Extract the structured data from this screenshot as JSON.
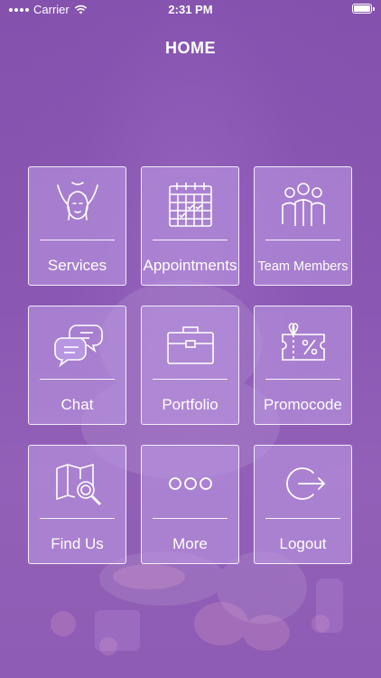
{
  "status_bar": {
    "carrier": "Carrier",
    "time": "2:31 PM"
  },
  "header": {
    "title": "HOME"
  },
  "menu": {
    "items": [
      {
        "label": "Services",
        "icon": "face-massage-icon"
      },
      {
        "label": "Appointments",
        "icon": "calendar-icon"
      },
      {
        "label": "Team Members",
        "icon": "team-icon"
      },
      {
        "label": "Chat",
        "icon": "chat-bubbles-icon"
      },
      {
        "label": "Portfolio",
        "icon": "briefcase-icon"
      },
      {
        "label": "Promocode",
        "icon": "gift-coupon-icon"
      },
      {
        "label": "Find Us",
        "icon": "map-search-icon"
      },
      {
        "label": "More",
        "icon": "more-dots-icon"
      },
      {
        "label": "Logout",
        "icon": "logout-icon"
      }
    ]
  },
  "colors": {
    "background": "#8452ad",
    "tile": "#b996e1",
    "text": "#ffffff"
  }
}
